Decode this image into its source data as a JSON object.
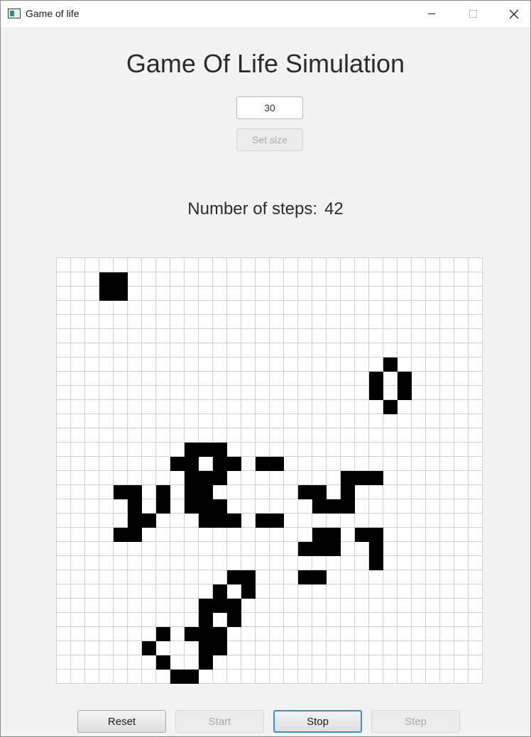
{
  "window": {
    "title": "Game of life"
  },
  "heading": "Game Of Life Simulation",
  "size_input": {
    "value": "30"
  },
  "set_size_label": "Set size",
  "steps": {
    "label": "Number of steps:",
    "value": "42"
  },
  "grid": {
    "rows": 30,
    "cols": 30,
    "alive_cells": [
      [
        1,
        3
      ],
      [
        1,
        4
      ],
      [
        2,
        3
      ],
      [
        2,
        4
      ],
      [
        7,
        23
      ],
      [
        8,
        22
      ],
      [
        8,
        24
      ],
      [
        9,
        22
      ],
      [
        9,
        24
      ],
      [
        10,
        23
      ],
      [
        13,
        9
      ],
      [
        13,
        10
      ],
      [
        13,
        11
      ],
      [
        14,
        8
      ],
      [
        14,
        9
      ],
      [
        14,
        11
      ],
      [
        14,
        12
      ],
      [
        14,
        14
      ],
      [
        14,
        15
      ],
      [
        15,
        9
      ],
      [
        15,
        10
      ],
      [
        15,
        11
      ],
      [
        15,
        20
      ],
      [
        15,
        21
      ],
      [
        15,
        22
      ],
      [
        16,
        4
      ],
      [
        16,
        5
      ],
      [
        16,
        7
      ],
      [
        16,
        9
      ],
      [
        16,
        10
      ],
      [
        16,
        17
      ],
      [
        16,
        18
      ],
      [
        16,
        20
      ],
      [
        17,
        5
      ],
      [
        17,
        7
      ],
      [
        17,
        9
      ],
      [
        17,
        10
      ],
      [
        17,
        11
      ],
      [
        17,
        18
      ],
      [
        17,
        19
      ],
      [
        17,
        20
      ],
      [
        18,
        5
      ],
      [
        18,
        6
      ],
      [
        18,
        10
      ],
      [
        18,
        11
      ],
      [
        18,
        12
      ],
      [
        18,
        14
      ],
      [
        18,
        15
      ],
      [
        19,
        4
      ],
      [
        19,
        5
      ],
      [
        19,
        18
      ],
      [
        19,
        19
      ],
      [
        19,
        21
      ],
      [
        19,
        22
      ],
      [
        20,
        17
      ],
      [
        20,
        18
      ],
      [
        20,
        19
      ],
      [
        20,
        22
      ],
      [
        21,
        22
      ],
      [
        22,
        12
      ],
      [
        22,
        13
      ],
      [
        22,
        17
      ],
      [
        22,
        18
      ],
      [
        23,
        11
      ],
      [
        23,
        13
      ],
      [
        24,
        10
      ],
      [
        24,
        11
      ],
      [
        24,
        12
      ],
      [
        25,
        10
      ],
      [
        25,
        12
      ],
      [
        26,
        7
      ],
      [
        26,
        9
      ],
      [
        26,
        10
      ],
      [
        26,
        11
      ],
      [
        27,
        6
      ],
      [
        27,
        10
      ],
      [
        27,
        11
      ],
      [
        28,
        7
      ],
      [
        28,
        10
      ],
      [
        29,
        8
      ],
      [
        29,
        9
      ]
    ]
  },
  "buttons": {
    "reset": "Reset",
    "start": "Start",
    "stop": "Stop",
    "step": "Step"
  }
}
